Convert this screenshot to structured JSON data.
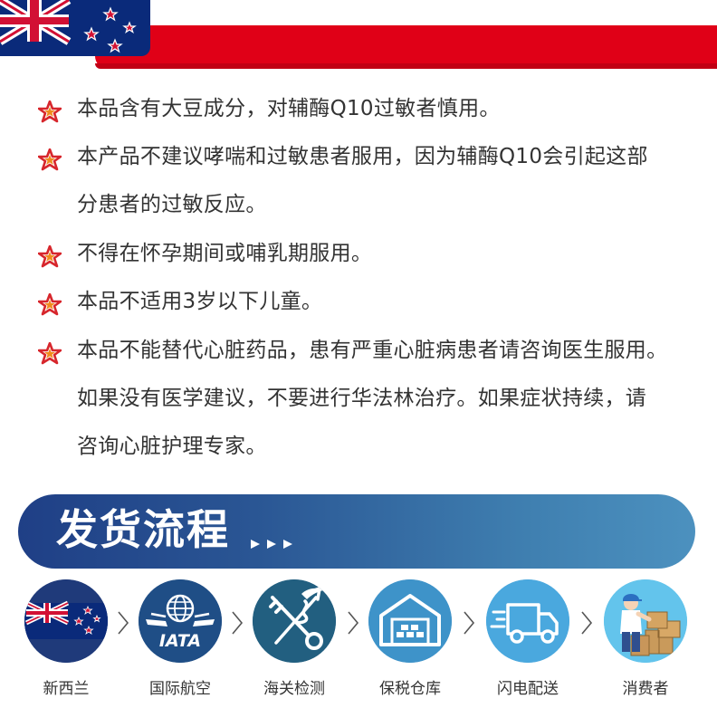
{
  "header": {
    "flag_icon": "new-zealand-flag-icon",
    "bar_color": "#e00017"
  },
  "warnings": [
    {
      "icon": "red-star-icon",
      "lines": [
        "本品含有大豆成分，对辅酶Q10过敏者慎用。"
      ]
    },
    {
      "icon": "red-star-icon",
      "lines": [
        "本产品不建议哮喘和过敏患者服用，因为辅酶Q10会引起这部",
        "分患者的过敏反应。"
      ]
    },
    {
      "icon": "red-star-icon",
      "lines": [
        "不得在怀孕期间或哺乳期服用。"
      ]
    },
    {
      "icon": "red-star-icon",
      "lines": [
        "本品不适用3岁以下儿童。"
      ]
    },
    {
      "icon": "red-star-icon",
      "lines": [
        "本品不能替代心脏药品，患有严重心脏病患者请咨询医生服用。",
        "如果没有医学建议，不要进行华法林治疗。如果症状持续，请",
        "咨询心脏护理专家。"
      ]
    }
  ],
  "banner": {
    "title": "发货流程",
    "arrows_icon": "triple-arrow-icon"
  },
  "steps": [
    {
      "label": "新西兰",
      "icon": "new-zealand-flag-icon"
    },
    {
      "label": "国际航空",
      "icon": "iata-icon"
    },
    {
      "label": "海关检测",
      "icon": "customs-icon"
    },
    {
      "label": "保税仓库",
      "icon": "warehouse-icon"
    },
    {
      "label": "闪电配送",
      "icon": "delivery-truck-icon"
    },
    {
      "label": "消费者",
      "icon": "consumer-icon"
    }
  ],
  "colors": {
    "accent_red": "#e00017",
    "star_red": "#d7262c",
    "banner_start": "#1f3f86",
    "banner_end": "#4c91bf",
    "step_dark_blue": "#1f4e86",
    "step_light_blue": "#48a3da"
  }
}
